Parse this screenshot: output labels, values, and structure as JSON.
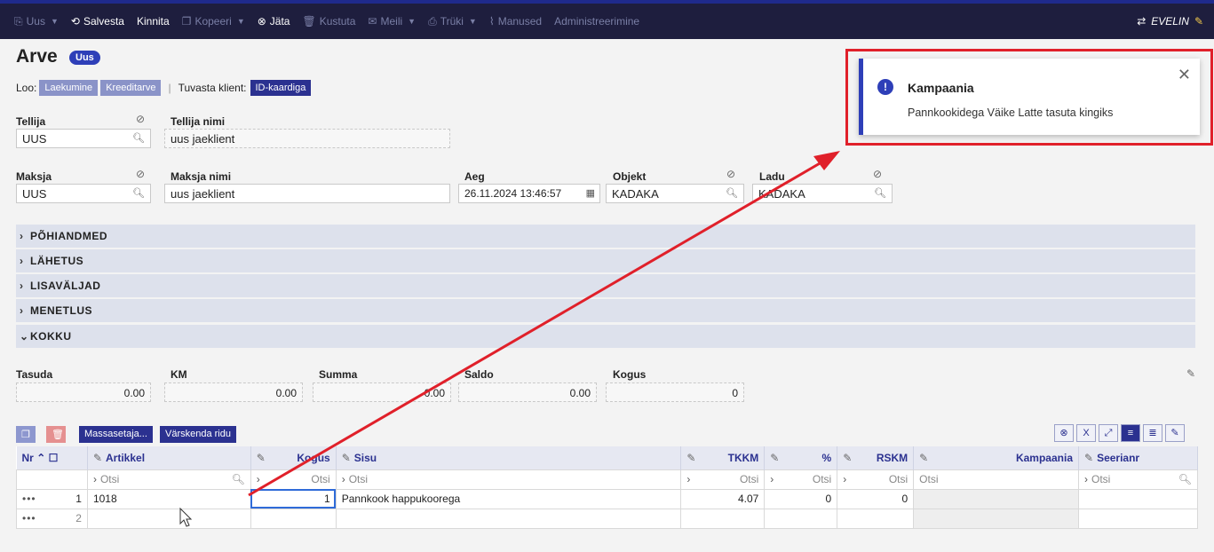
{
  "toolbar": {
    "items": [
      {
        "label": "Uus",
        "icon": "new-doc-icon",
        "caret": true,
        "state": "dim"
      },
      {
        "label": "Salvesta",
        "icon": "save-icon",
        "caret": false,
        "state": "bright"
      },
      {
        "label": "Kinnita",
        "icon": "",
        "caret": false,
        "state": "bright"
      },
      {
        "label": "Kopeeri",
        "icon": "copy-icon",
        "caret": true,
        "state": "dim"
      },
      {
        "label": "Jäta",
        "icon": "cancel-icon",
        "caret": false,
        "state": "bright"
      },
      {
        "label": "Kustuta",
        "icon": "trash-icon",
        "caret": false,
        "state": "dim"
      },
      {
        "label": "Meili",
        "icon": "mail-icon",
        "caret": true,
        "state": "dim"
      },
      {
        "label": "Trüki",
        "icon": "print-icon",
        "caret": true,
        "state": "dim"
      },
      {
        "label": "Manused",
        "icon": "paperclip-icon",
        "caret": false,
        "state": "dim"
      },
      {
        "label": "Administreerimine",
        "icon": "",
        "caret": false,
        "state": "dim"
      }
    ],
    "user": "EVELIN"
  },
  "header": {
    "title": "Arve",
    "badge": "Uus"
  },
  "loo": {
    "label": "Loo:",
    "btn1": "Laekumine",
    "btn2": "Kreeditarve",
    "check_label": "Tuvasta klient:",
    "check_btn": "ID-kaardiga"
  },
  "fields": {
    "tellija": {
      "label": "Tellija",
      "value": "UUS"
    },
    "tellija_nimi": {
      "label": "Tellija nimi",
      "value": "uus jaeklient"
    },
    "maksja": {
      "label": "Maksja",
      "value": "UUS"
    },
    "maksja_nimi": {
      "label": "Maksja nimi",
      "value": "uus jaeklient"
    },
    "aeg": {
      "label": "Aeg",
      "value": "26.11.2024 13:46:57"
    },
    "objekt": {
      "label": "Objekt",
      "value": "KADAKA"
    },
    "ladu": {
      "label": "Ladu",
      "value": "KADAKA"
    }
  },
  "sections": [
    "PÕHIANDMED",
    "LÄHETUS",
    "LISAVÄLJAD",
    "MENETLUS",
    "KOKKU"
  ],
  "totals": {
    "tasuda": {
      "label": "Tasuda",
      "value": "0.00"
    },
    "km": {
      "label": "KM",
      "value": "0.00"
    },
    "summa": {
      "label": "Summa",
      "value": "0.00"
    },
    "saldo": {
      "label": "Saldo",
      "value": "0.00"
    },
    "kogus": {
      "label": "Kogus",
      "value": "0"
    }
  },
  "grid_buttons": {
    "mass": "Massasetaja...",
    "refresh": "Värskenda ridu"
  },
  "grid": {
    "columns": {
      "nr": "Nr",
      "artikkel": "Artikkel",
      "kogus": "Kogus",
      "sisu": "Sisu",
      "tkkm": "TKKM",
      "pct": "%",
      "rskm": "RSKM",
      "kampaania": "Kampaania",
      "seerianr": "Seerianr"
    },
    "search_placeholder": "Otsi",
    "rows": [
      {
        "nr": "1",
        "artikkel": "1018",
        "kogus": "1",
        "sisu": "Pannkook happukoorega",
        "tkkm": "4.07",
        "pct": "0",
        "rskm": "0"
      },
      {
        "nr": "2",
        "artikkel": "",
        "kogus": "",
        "sisu": "",
        "tkkm": "",
        "pct": "",
        "rskm": ""
      }
    ]
  },
  "toast": {
    "title": "Kampaania",
    "text": "Pannkookidega Väike Latte tasuta kingiks"
  },
  "colors": {
    "toolbar_bg": "#1e1e3e",
    "accent": "#2e3fb8",
    "annotation": "#e0202a"
  }
}
